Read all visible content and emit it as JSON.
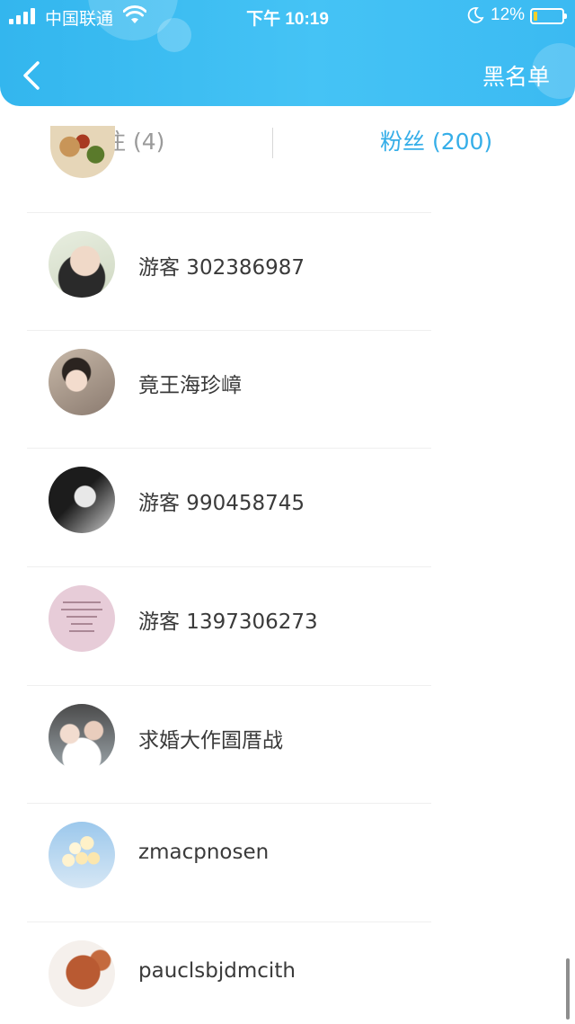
{
  "status_bar": {
    "carrier": "中国联通",
    "time": "下午 10:19",
    "battery_percent": "12%",
    "battery_level": 0.12,
    "icons": [
      "signal-icon",
      "wifi-icon",
      "moon-icon",
      "battery-icon"
    ]
  },
  "header": {
    "back_icon": "back-chevron-icon",
    "blacklist_label": "黑名单",
    "gradient_colors": [
      "#33b6ee",
      "#45c3f5"
    ]
  },
  "tabs": {
    "follow_label": "关注 (4)",
    "fans_label": "粉丝 (200)",
    "active": "fans",
    "active_color": "#35aee8",
    "inactive_color": "#9a9a9a"
  },
  "fans": [
    {
      "name": "游客 302386987"
    },
    {
      "name": "竟王海珍嶂"
    },
    {
      "name": "游客 990458745"
    },
    {
      "name": "游客 1397306273"
    },
    {
      "name": "求婚大作圄厝战"
    },
    {
      "name": "zmacpnosen"
    },
    {
      "name": "pauclsbjdmcith"
    }
  ]
}
